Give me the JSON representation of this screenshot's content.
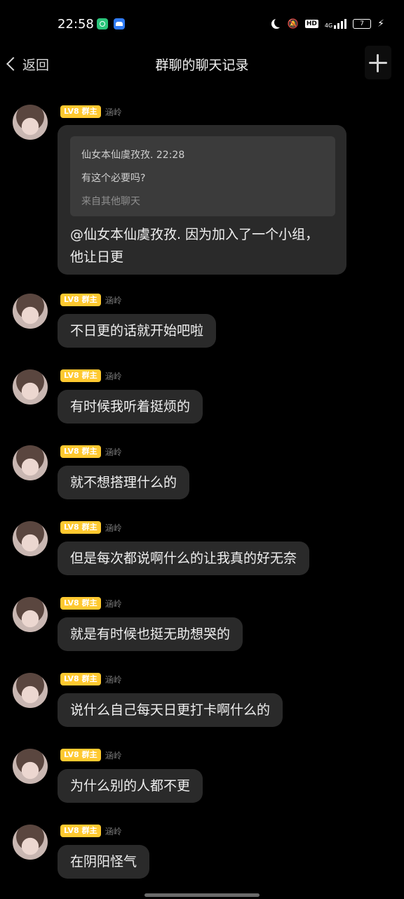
{
  "status_bar": {
    "time": "22:58",
    "right_text": "4G",
    "hd": "HD",
    "battery": "7"
  },
  "header": {
    "back_label": "返回",
    "title": "群聊的聊天记录"
  },
  "badges": {
    "level": "LV8",
    "role": "群主"
  },
  "messages": [
    {
      "nickname": "涵岭",
      "quote": {
        "line1": "仙女本仙虞孜孜. 22:28",
        "line2": "有这个必要吗?",
        "source": "来自其他聊天"
      },
      "text": "@仙女本仙虞孜孜. 因为加入了一个小组，他让日更"
    },
    {
      "nickname": "涵岭",
      "text": "不日更的话就开始吧啦"
    },
    {
      "nickname": "涵岭",
      "text": "有时候我听着挺烦的"
    },
    {
      "nickname": "涵岭",
      "text": "就不想搭理什么的"
    },
    {
      "nickname": "涵岭",
      "text": "但是每次都说啊什么的让我真的好无奈"
    },
    {
      "nickname": "涵岭",
      "text": "就是有时候也挺无助想哭的"
    },
    {
      "nickname": "涵岭",
      "text": "说什么自己每天日更打卡啊什么的"
    },
    {
      "nickname": "涵岭",
      "text": "为什么别的人都不更"
    },
    {
      "nickname": "涵岭",
      "text": "在阴阳怪气"
    }
  ]
}
